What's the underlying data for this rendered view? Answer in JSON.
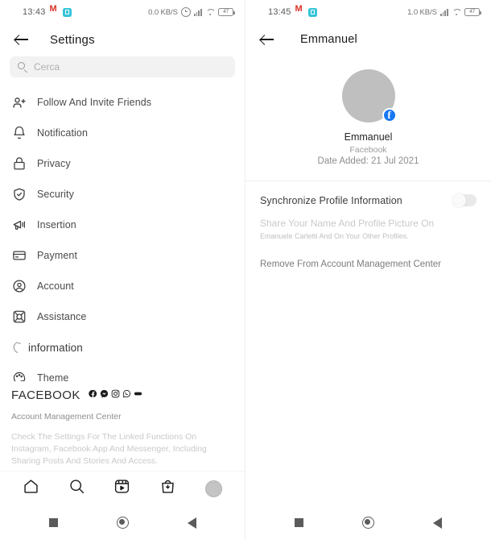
{
  "left": {
    "status": {
      "time": "13:43",
      "icons": [
        "gmail-icon",
        "app-icon"
      ],
      "network": "0.0 KB/S",
      "alarm": "alarm-icon",
      "signal": "signal-icon",
      "wifi": "wifi-icon",
      "battery": "47"
    },
    "appbar": {
      "back": "back-arrow",
      "title": "Settings"
    },
    "search": {
      "icon": "search-icon",
      "placeholder": "Cerca"
    },
    "menu": [
      {
        "icon": "add-person-icon",
        "label": "Follow And Invite Friends"
      },
      {
        "icon": "bell-icon",
        "label": "Notification"
      },
      {
        "icon": "lock-icon",
        "label": "Privacy"
      },
      {
        "icon": "shield-check-icon",
        "label": "Security"
      },
      {
        "icon": "megaphone-icon",
        "label": "Insertion"
      },
      {
        "icon": "credit-card-icon",
        "label": "Payment"
      },
      {
        "icon": "account-circle-icon",
        "label": "Account"
      },
      {
        "icon": "lifebuoy-icon",
        "label": "Assistance"
      },
      {
        "icon": "info-icon",
        "label": "information"
      },
      {
        "icon": "palette-icon",
        "label": "Theme"
      }
    ],
    "footer": {
      "title": "FACEBOOK",
      "social_icons": [
        "facebook-icon",
        "messenger-icon",
        "instagram-icon",
        "whatsapp-icon",
        "meta-icon"
      ],
      "link": "Account Management Center",
      "description": "Check The Settings For The Linked Functions On Instagram, Facebook App And Messenger, Including Sharing Posts And Stories And Access."
    },
    "appnav": [
      "home-icon",
      "search-icon",
      "reels-icon",
      "shop-icon",
      "profile-avatar"
    ],
    "sysnav": [
      "recents-button",
      "home-button",
      "back-button"
    ]
  },
  "right": {
    "status": {
      "time": "13:45",
      "icons": [
        "gmail-icon",
        "app-icon"
      ],
      "network": "1.0 KB/S",
      "signal": "signal-icon",
      "wifi": "wifi-icon",
      "battery": "47"
    },
    "appbar": {
      "back": "back-arrow",
      "title": "Emmanuel"
    },
    "profile": {
      "avatar": "profile-avatar",
      "badge": "facebook-badge-icon",
      "name": "Emmanuel",
      "source": "Facebook",
      "date_added": "Date Added: 21 Jul 2021"
    },
    "sync": {
      "label": "Synchronize Profile Information",
      "toggle_state": "off",
      "description_primary": "Share Your Name And Profile Picture On",
      "description_secondary": "Emanuele Carletti And On Your Other Profiles."
    },
    "remove_link": "Remove From Account Management Center",
    "sysnav": [
      "recents-button",
      "home-button",
      "back-button"
    ]
  },
  "colors": {
    "facebook_blue": "#1877f2",
    "gmail_red": "#d93025",
    "app_teal": "#35c4d7",
    "avatar_gray": "#bfbfbf"
  }
}
